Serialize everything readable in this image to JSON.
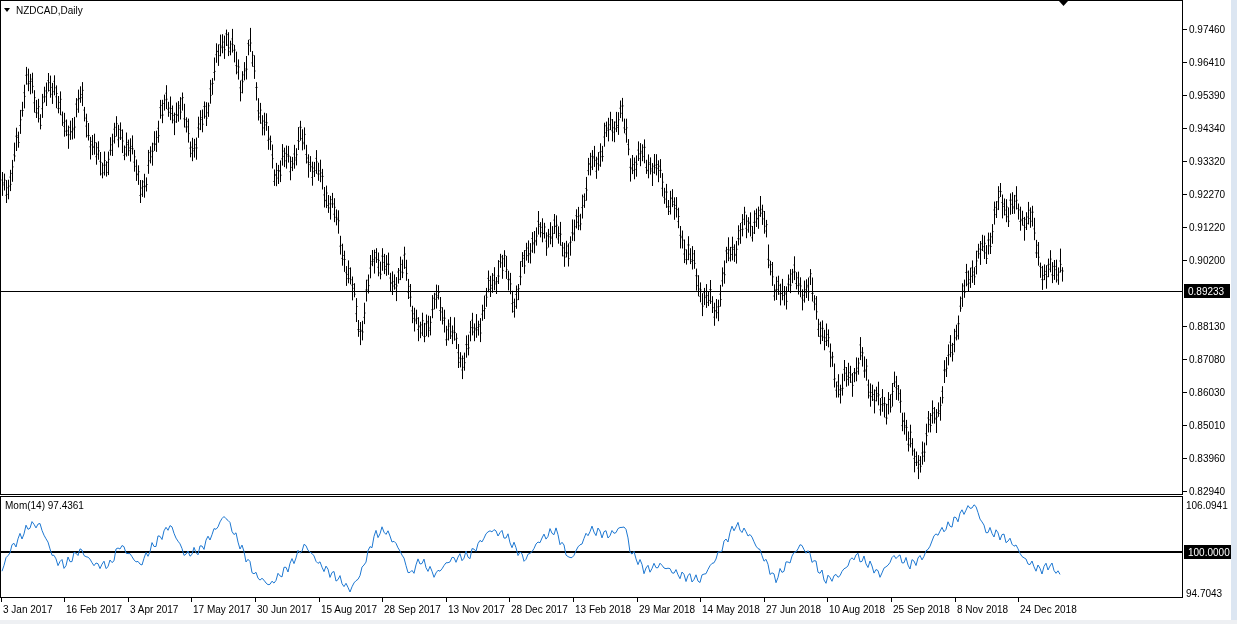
{
  "chart": {
    "title": "NZDCAD,Daily",
    "price_axis": [
      "0.97460",
      "0.96410",
      "0.95390",
      "0.94340",
      "0.93320",
      "0.92270",
      "0.91220",
      "0.90200",
      "0.88130",
      "0.87080",
      "0.86030",
      "0.85010",
      "0.83960",
      "0.82940"
    ],
    "current_price": "0.89233"
  },
  "indicator": {
    "title": "Mom(14) 97.4361",
    "axis": [
      "106.0941",
      "100.0000",
      "94.7043"
    ]
  },
  "time_axis": [
    "3 Jan 2017",
    "16 Feb 2017",
    "3 Apr 2017",
    "17 May 2017",
    "30 Jun 2017",
    "15 Aug 2017",
    "28 Sep 2017",
    "13 Nov 2017",
    "28 Dec 2017",
    "13 Feb 2018",
    "29 Mar 2018",
    "14 May 2018",
    "27 Jun 2018",
    "10 Aug 2018",
    "25 Sep 2018",
    "8 Nov 2018",
    "24 Dec 2018"
  ]
}
